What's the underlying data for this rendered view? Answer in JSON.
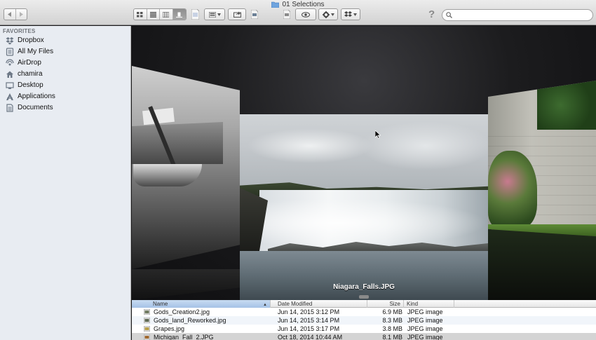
{
  "window": {
    "title": "01 Selections"
  },
  "toolbar": {
    "search_placeholder": "",
    "help_glyph": "?"
  },
  "sidebar": {
    "heading": "FAVORITES",
    "items": [
      {
        "label": "Dropbox",
        "icon": "dropbox-icon"
      },
      {
        "label": "All My Files",
        "icon": "all-files-icon"
      },
      {
        "label": "AirDrop",
        "icon": "airdrop-icon"
      },
      {
        "label": "chamira",
        "icon": "home-icon"
      },
      {
        "label": "Desktop",
        "icon": "desktop-icon"
      },
      {
        "label": "Applications",
        "icon": "applications-icon"
      },
      {
        "label": "Documents",
        "icon": "documents-icon"
      }
    ]
  },
  "coverflow": {
    "caption": "Niagara_Falls.JPG"
  },
  "list": {
    "columns": {
      "name": "Name",
      "date": "Date Modified",
      "size": "Size",
      "kind": "Kind"
    },
    "rows": [
      {
        "name": "Gods_Creation2.jpg",
        "date": "Jun 14, 2015 3:12 PM",
        "size": "6.9 MB",
        "kind": "JPEG image"
      },
      {
        "name": "Gods_land_Reworked.jpg",
        "date": "Jun 14, 2015 3:14 PM",
        "size": "8.3 MB",
        "kind": "JPEG image"
      },
      {
        "name": "Grapes.jpg",
        "date": "Jun 14, 2015 3:17 PM",
        "size": "3.8 MB",
        "kind": "JPEG image"
      },
      {
        "name": "Michigan_Fall_2.JPG",
        "date": "Oct 18, 2014 10:44 AM",
        "size": "8.1 MB",
        "kind": "JPEG image"
      }
    ]
  }
}
